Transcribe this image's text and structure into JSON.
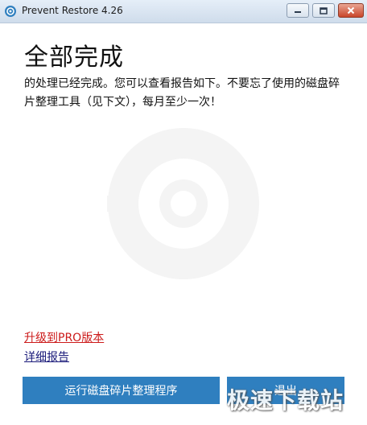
{
  "window": {
    "title": "Prevent Restore 4.26",
    "icon": "app-logo-icon",
    "controls": {
      "minimize": "minimize-icon",
      "maximize": "maximize-icon",
      "close": "close-icon"
    }
  },
  "main": {
    "heading": "全部完成",
    "message": "的处理已经完成。您可以查看报告如下。不要忘了使用的磁盘碎片整理工具（见下文），每月至少一次！",
    "links": {
      "upgrade": "升级到PRO版本",
      "details": "详细报告"
    },
    "buttons": {
      "defrag": "运行磁盘碎片整理程序",
      "exit": "退出"
    },
    "watermark": "极速下载站"
  },
  "colors": {
    "link_red": "#cc1a1a",
    "link_dark": "#1a1a7a",
    "button_blue": "#2f7fbf"
  }
}
